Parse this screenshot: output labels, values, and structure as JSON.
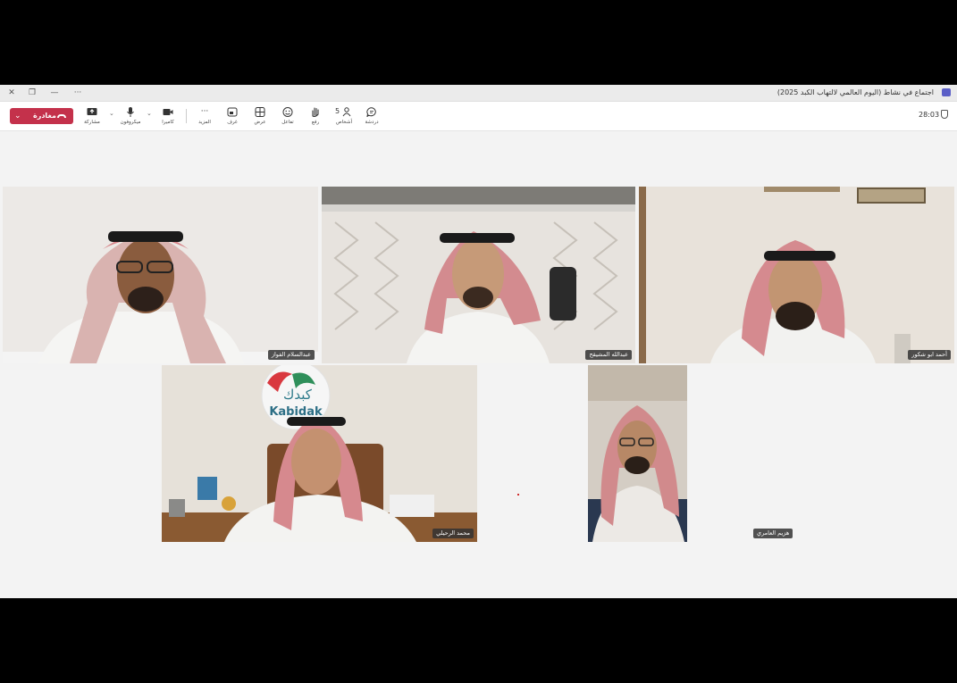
{
  "window": {
    "title": "اجتماع في نشاط (اليوم العالمي لالتهاب الكبد 2025)",
    "timer": "28:03"
  },
  "toolbar": {
    "leave_label": "مغادرة",
    "share_label": "مشاركة",
    "mic_label": "ميكروفون",
    "camera_label": "كاميرا",
    "more_label": "المزيد",
    "rooms_label": "غرف",
    "view_label": "عرض",
    "react_label": "تفاعل",
    "raise_label": "رفع",
    "people_label": "أشخاص",
    "people_count": "5",
    "chat_label": "دردشة"
  },
  "participants": [
    {
      "name": "عبدالسلام الفواز"
    },
    {
      "name": "عبدالله المشيقح"
    },
    {
      "name": "أحمد ابو شكور"
    },
    {
      "name": "محمد الرحيلي"
    },
    {
      "name": "هزيم العامري"
    }
  ],
  "logo": {
    "arabic": "كبدك",
    "latin": "Kabidak"
  },
  "colors": {
    "leave": "#c4314b",
    "active_border": "#7f85f5",
    "accent": "#5b5fc7"
  }
}
